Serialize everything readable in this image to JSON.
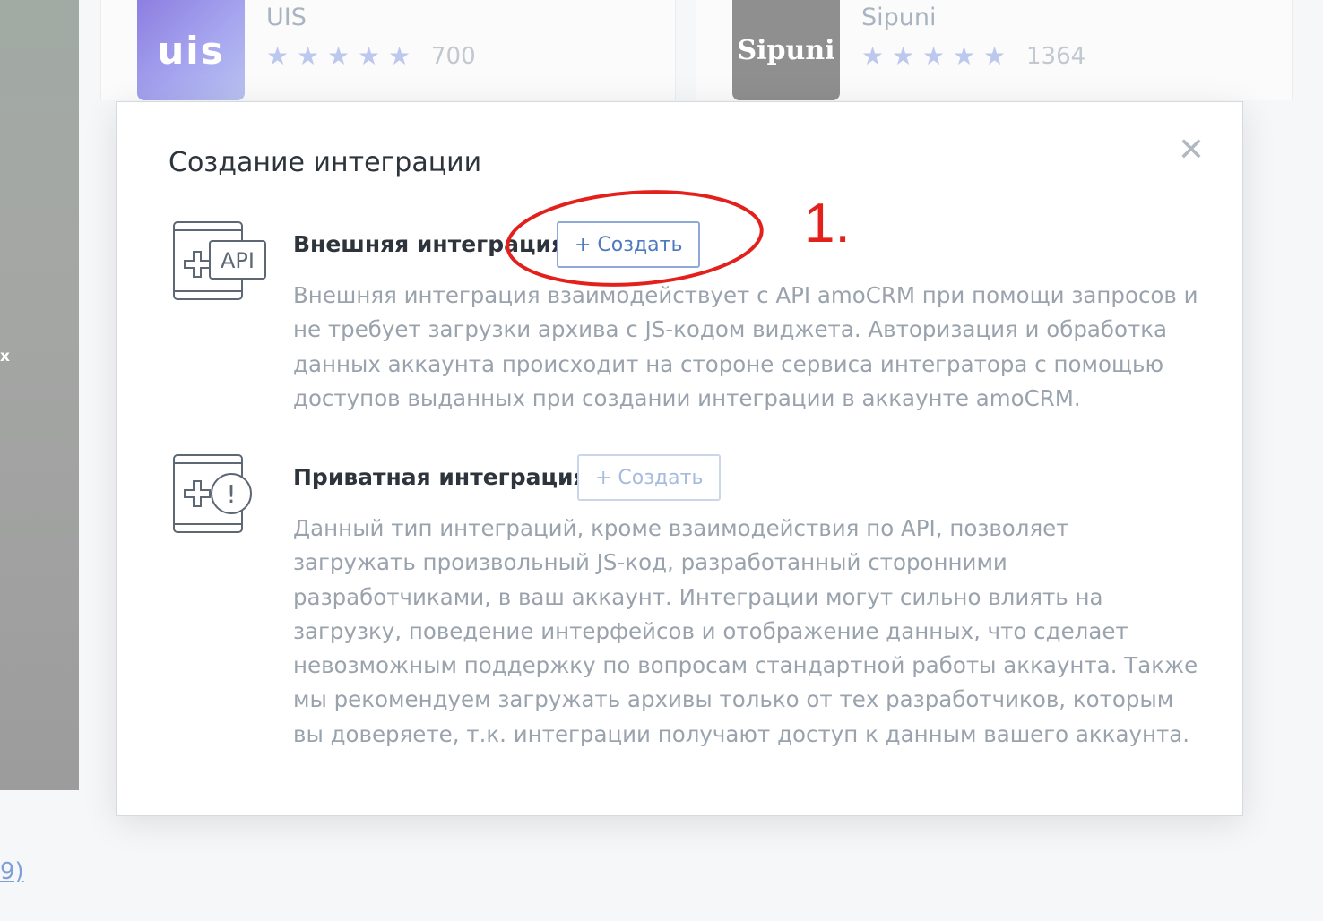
{
  "background": {
    "left_panel_fragment": "x",
    "bottom_link_fragment": "9)",
    "cards": [
      {
        "logo_text": "uis",
        "name": "UIS",
        "rating_count": "700",
        "rating_value": 4.5
      },
      {
        "logo_text": "Sipuni",
        "name": "Sipuni",
        "rating_count": "1364",
        "rating_value": 4.5
      }
    ]
  },
  "modal": {
    "title": "Создание интеграции",
    "close_icon": "close-icon",
    "sections": [
      {
        "icon": "api-integration-icon",
        "icon_label": "API",
        "title": "Внешняя интеграция",
        "button_label": "+ Создать",
        "button_enabled": true,
        "description": "Внешняя интеграция взаимодействует с API amoCRM при помощи запросов и не требует загрузки архива с JS-кодом виджета. Авторизация и обработка данных аккаунта происходит на стороне сервиса интегратора с помощью доступов выданных при создании интеграции в аккаунте amoCRM."
      },
      {
        "icon": "private-integration-icon",
        "icon_label": "!",
        "title": "Приватная интеграция",
        "button_label": "+ Создать",
        "button_enabled": false,
        "description": "Данный тип интеграций, кроме взаимодействия по API, позволяет загружать произвольный JS-код, разработанный сторонними разработчиками, в ваш аккаунт. Интеграции могут сильно влиять на загрузку, поведение интерфейсов и отображение данных, что сделает невозможным поддержку по вопросам стандартной работы аккаунта. Также мы рекомендуем загружать архивы только от тех разработчиков, которым вы доверяете, т.к. интеграции получают доступ к данным вашего аккаунта."
      }
    ]
  },
  "annotation": {
    "label": "1.",
    "color": "#e3201b"
  },
  "colors": {
    "accent": "#4f79be",
    "button_border": "#8ea9d6",
    "text_dark": "#2d343b",
    "text_muted": "#9aa3ad"
  }
}
